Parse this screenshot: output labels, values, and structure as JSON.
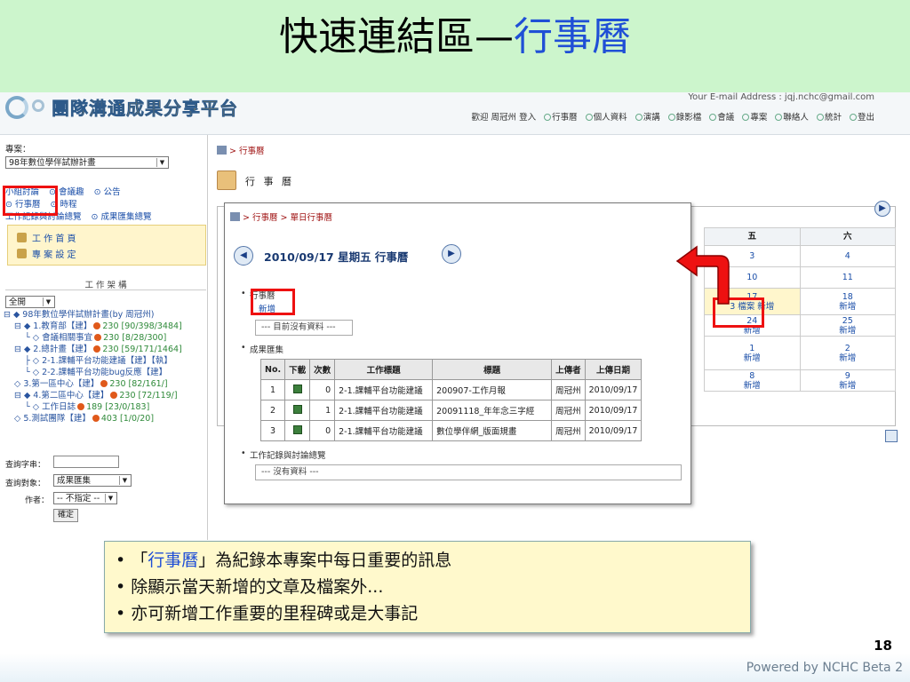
{
  "slide": {
    "title_main": "快速連結區—",
    "title_accent": "行事曆",
    "page_number": "18",
    "powered_by": "Powered by NCHC Beta 2"
  },
  "header": {
    "platform_name": "團隊溝通成果分享平台",
    "email": "Your E-mail Address : jqj.nchc@gmail.com",
    "welcome": "歡迎 周冠州 登入",
    "nav": [
      "行事曆",
      "個人資料",
      "演講",
      "錄影檔",
      "會議",
      "專案",
      "聯絡人",
      "統計",
      "登出"
    ]
  },
  "left_panel": {
    "project_label": "專案：",
    "project_value": "98年數位學伴試辦計畫",
    "links_row1": [
      "小組討論",
      "會議趣",
      "公告"
    ],
    "links_row2": [
      "行事曆",
      "時程"
    ],
    "links_row3": [
      "工作記錄與討論總覽",
      "成果匯集總覽"
    ],
    "menu": [
      "工 作 首 頁",
      "專 案 設 定"
    ],
    "structure_title": "工 作 架 構",
    "expand_value": "全開",
    "tree": [
      "⊟ ◆ 98年數位學伴試辦計畫(by 周冠州)",
      "⊟ ◆ 1.教育部【建】",
      "└ ◇ 會議相關事宜",
      "⊟ ◆ 2.總計畫【建】",
      "├ ◇ 2-1.課輔平台功能建議【建】【執】",
      "└ ◇ 2-2.課輔平台功能bug反應【建】",
      "◇ 3.第一區中心【建】",
      "⊟ ◆ 4.第二區中心【建】",
      "└ ◇ 工作日誌",
      "◇ 5.測試團隊【建】"
    ],
    "tree_stats": [
      "",
      "230 [90/398/3484]",
      "230 [8/28/300]",
      "230 [59/171/1464]",
      "",
      "",
      "230 [82/161/]",
      "230 [72/119/]",
      "189 [23/0/183]",
      "403 [1/0/20]"
    ],
    "query_label": "查詢字串：",
    "target_label": "查詢對象：",
    "target_value": "成果匯集",
    "author_label": "作者：",
    "author_value": "-- 不指定 --",
    "submit_label": "確定"
  },
  "main": {
    "breadcrumb": "> 行事曆",
    "calendar_title": "行 事 曆",
    "weekday_headers": [
      "五",
      "六"
    ],
    "calendar_rows": [
      [
        "3",
        "4"
      ],
      [
        "10",
        "11"
      ],
      [
        "17\n3 檔案 新增",
        "18\n新增"
      ],
      [
        "24\n新增",
        "25\n新增"
      ],
      [
        "1\n新增",
        "2\n新增"
      ],
      [
        "8\n新增",
        "9\n新增"
      ]
    ]
  },
  "popup": {
    "breadcrumb": "> 行事曆 > 單日行事曆",
    "date_title": "2010/09/17 星期五 行事曆",
    "section1": "行事曆",
    "add_link": "新增",
    "empty1": "--- 目前沒有資料 ---",
    "section2": "成果匯集",
    "table_headers": [
      "No.",
      "下載",
      "次數",
      "工作標題",
      "標題",
      "上傳者",
      "上傳日期"
    ],
    "table_rows": [
      [
        "1",
        "",
        "0",
        "2-1.課輔平台功能建議",
        "200907-工作月報",
        "周冠州",
        "2010/09/17"
      ],
      [
        "2",
        "",
        "1",
        "2-1.課輔平台功能建議",
        "20091118_年年念三字經",
        "周冠州",
        "2010/09/17"
      ],
      [
        "3",
        "",
        "0",
        "2-1.課輔平台功能建議",
        "數位學伴網_版面規畫",
        "周冠州",
        "2010/09/17"
      ]
    ],
    "section3": "工作記錄與討論總覽",
    "empty2": "--- 沒有資料 ---"
  },
  "notes": {
    "line1_pre": "「",
    "line1_accent": "行事曆",
    "line1_post": "」為紀錄本專案中每日重要的訊息",
    "line2": "除顯示當天新增的文章及檔案外...",
    "line3": "亦可新增工作重要的里程碑或是大事記"
  },
  "colors": {
    "title_band": "#ccf5cc",
    "accent_blue": "#1f4fd6",
    "highlight_red": "#e11111",
    "note_bg": "#fff9cc"
  }
}
